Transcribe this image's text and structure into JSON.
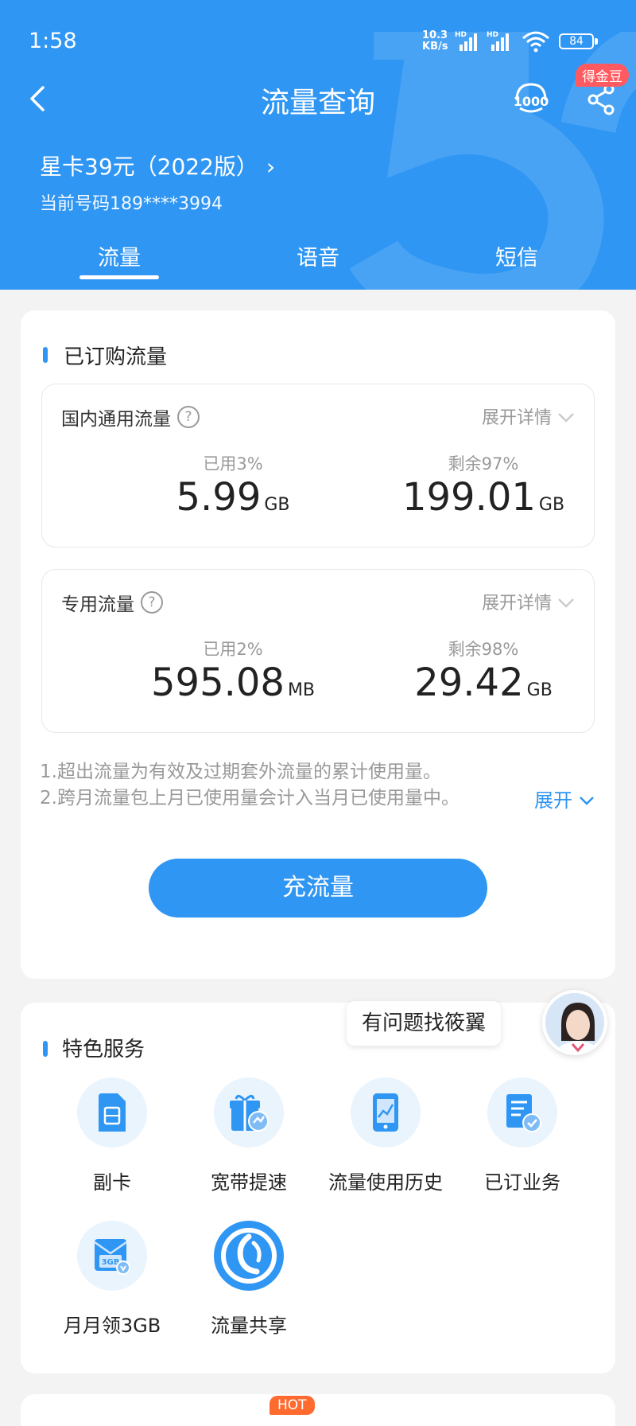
{
  "status_bar": {
    "time": "1:58",
    "speed_value": "10.3",
    "speed_unit": "KB/s",
    "battery": "84"
  },
  "header": {
    "title": "流量查询",
    "badge": "得金豆",
    "plan": "星卡39元（2022版）",
    "phone": "当前号码189****3994"
  },
  "tabs": [
    {
      "label": "流量"
    },
    {
      "label": "语音"
    },
    {
      "label": "短信"
    }
  ],
  "subscribed": {
    "title": "已订购流量",
    "general": {
      "title": "国内通用流量",
      "expand": "展开详情",
      "used_label": "已用3%",
      "used_value": "5.99",
      "used_unit": "GB",
      "remain_label": "剩余97%",
      "remain_value": "199.01",
      "remain_unit": "GB"
    },
    "dedicated": {
      "title": "专用流量",
      "expand": "展开详情",
      "used_label": "已用2%",
      "used_value": "595.08",
      "used_unit": "MB",
      "remain_label": "剩余98%",
      "remain_value": "29.42",
      "remain_unit": "GB"
    },
    "notes": [
      "1.超出流量为有效及过期套外流量的累计使用量。",
      "2.跨月流量包上月已使用量会计入当月已使用量中。"
    ],
    "notes_more": "展开",
    "recharge_button": "充流量"
  },
  "assistant": {
    "bubble": "有问题找筱翼"
  },
  "features": {
    "title": "特色服务",
    "items": [
      {
        "label": "副卡",
        "icon": "sim-card-icon"
      },
      {
        "label": "宽带提速",
        "icon": "gift-speed-icon"
      },
      {
        "label": "流量使用历史",
        "icon": "phone-chart-icon"
      },
      {
        "label": "已订业务",
        "icon": "document-check-icon"
      },
      {
        "label": "月月领3GB",
        "icon": "envelope-3gb-icon"
      },
      {
        "label": "流量共享",
        "icon": "share-circle-icon"
      }
    ]
  },
  "hot_badge": "HOT",
  "colors": {
    "primary": "#2f96f3",
    "badge": "#ff5a5f",
    "hot": "#ff6a2f"
  }
}
